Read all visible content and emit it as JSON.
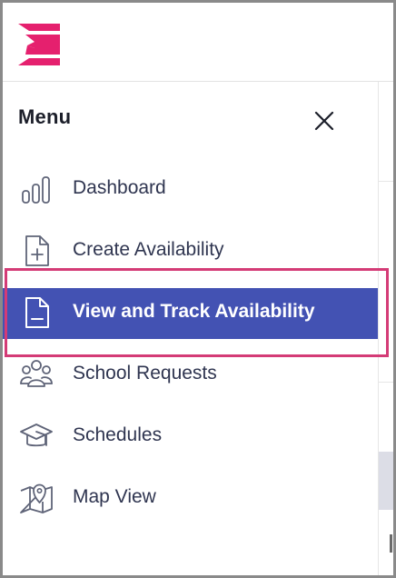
{
  "brand": {
    "logo_icon": "brand-logo-icon",
    "logo_color": "#e5206e"
  },
  "menu": {
    "title": "Menu",
    "close_icon": "close-icon",
    "items": [
      {
        "label": "Dashboard",
        "icon": "bar-chart-icon",
        "active": false
      },
      {
        "label": "Create Availability",
        "icon": "file-plus-icon",
        "active": false
      },
      {
        "label": "View and Track Availability",
        "icon": "file-text-icon",
        "active": true
      },
      {
        "label": "School Requests",
        "icon": "users-group-icon",
        "active": false
      },
      {
        "label": "Schedules",
        "icon": "graduation-cap-icon",
        "active": false
      },
      {
        "label": "Map View",
        "icon": "map-pin-icon",
        "active": false
      }
    ]
  },
  "colors": {
    "accent": "#4352b3",
    "focus": "#d43b76",
    "brand": "#e5206e",
    "text": "#2f3550"
  }
}
